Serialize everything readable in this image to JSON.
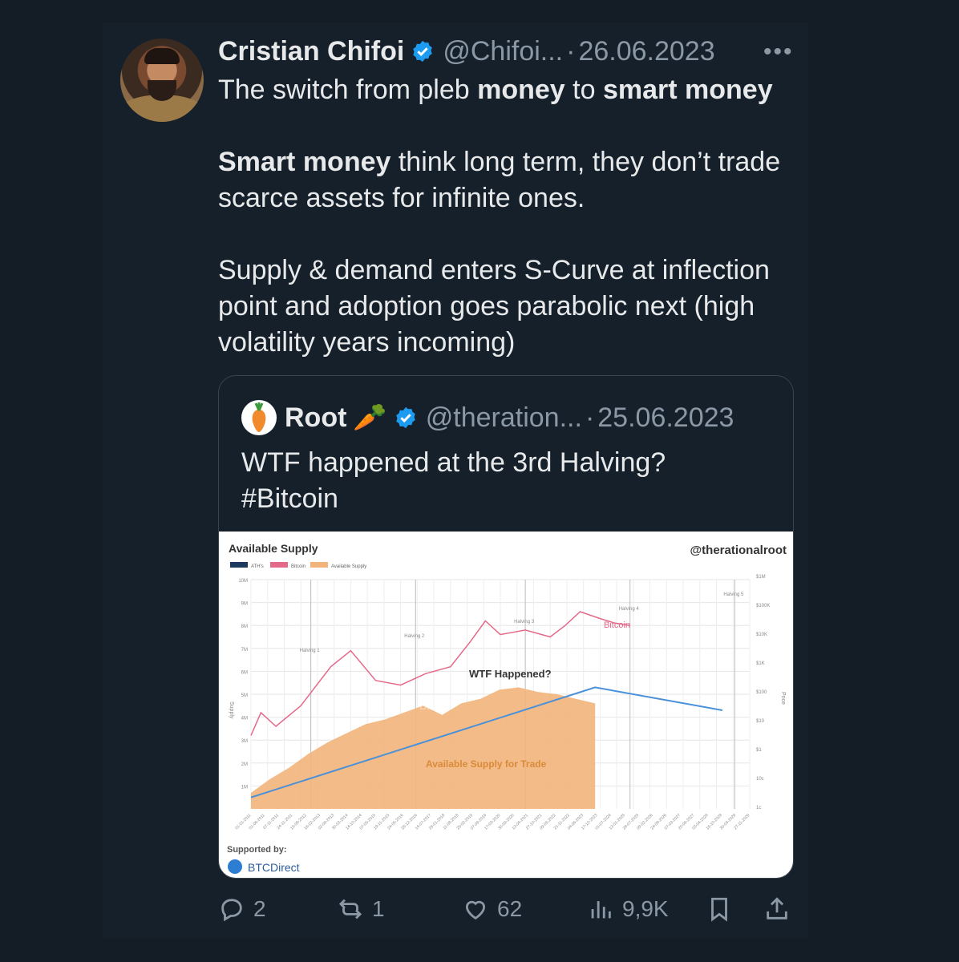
{
  "tweet": {
    "author_name": "Cristian Chifoi",
    "handle": "@Chifoi...",
    "separator": "·",
    "date": "26.06.2023",
    "more_label": "•••",
    "paragraphs": [
      [
        {
          "t": "The switch from pleb ",
          "b": false
        },
        {
          "t": "money",
          "b": true
        },
        {
          "t": " to ",
          "b": false
        },
        {
          "t": "smart money",
          "b": true
        }
      ],
      [
        {
          "t": "Smart money",
          "b": true
        },
        {
          "t": " think long term, they don’t trade scarce assets for infinite ones.",
          "b": false
        }
      ],
      [
        {
          "t": "Supply & demand enters S-Curve at inflection point and adoption goes parabolic next (high volatility years incoming)",
          "b": false
        }
      ]
    ]
  },
  "quote": {
    "author_name": "Root",
    "emoji": "🥕",
    "handle": "@theration...",
    "separator": "·",
    "date": "25.06.2023",
    "text_line1": "WTF happened at the 3rd Halving?",
    "text_line2": "#Bitcoin"
  },
  "chart_data": {
    "type": "area",
    "title": "Available Supply",
    "brand": "@therationalroot",
    "legend": [
      "ATH's",
      "Bitcoin",
      "Available Supply"
    ],
    "legend_colors": [
      "#1f3a5f",
      "#e46a8a",
      "#f2b47a"
    ],
    "ylabel_left": "Supply",
    "ylabel_right": "Price",
    "y_left_ticks": [
      "10M",
      "9M",
      "8M",
      "7M",
      "6M",
      "5M",
      "4M",
      "3M",
      "2M",
      "1M"
    ],
    "y_right_ticks": [
      "$1M",
      "$100K",
      "$10K",
      "$1K",
      "$100",
      "$10",
      "$1",
      "10c",
      "1c"
    ],
    "halvings": [
      "Halving 1",
      "Halving 2",
      "Halving 3",
      "Halving 4",
      "Halving 5"
    ],
    "annotation": "WTF Happened?",
    "area_label": "Available Supply for Trade",
    "price_label": "Bitcoin",
    "watermark": "Bitcoin",
    "footer_supported": "Supported by:",
    "footer_brand": "BTCDirect",
    "x_ticks": [
      "01-01-2011",
      "01-06-2011",
      "07-11-2011",
      "24-11-2011",
      "15-08-2012",
      "16-02-2013",
      "02-09-2013",
      "30-03-2014",
      "14-10-2014",
      "07-05-2015",
      "19-11-2015",
      "24-05-2016",
      "28-12-2016",
      "14-07-2017",
      "29-01-2018",
      "11-08-2018",
      "25-02-2019",
      "07-09-2019",
      "17-03-2020",
      "30-09-2020",
      "13-04-2021",
      "27-10-2021",
      "09-05-2022",
      "21-11-2022",
      "04-06-2023",
      "17-12-2023",
      "01-07-2024",
      "13-01-2025",
      "28-07-2025",
      "09-02-2026",
      "24-08-2026",
      "07-03-2027",
      "20-09-2027",
      "03-04-2028",
      "16-10-2028",
      "30-04-2029",
      "27-11-2029"
    ],
    "supply_millions": [
      0.7,
      1.3,
      1.8,
      2.4,
      2.9,
      3.3,
      3.7,
      3.9,
      4.2,
      4.5,
      4.1,
      4.6,
      4.8,
      5.2,
      5.3,
      5.1,
      5.0,
      4.8,
      4.6
    ],
    "trend_line_millions": [
      [
        0,
        0.5
      ],
      [
        0.73,
        5.3
      ],
      [
        1.0,
        4.3
      ]
    ]
  },
  "actions": {
    "replies": "2",
    "retweets": "1",
    "likes": "62",
    "views": "9,9K"
  },
  "colors": {
    "background": "#141d26",
    "text": "#e7e9ea",
    "muted": "#8b98a5",
    "verified": "#1d9bf0",
    "supply_area": "#f2b47a",
    "price_line": "#e46a8a"
  }
}
